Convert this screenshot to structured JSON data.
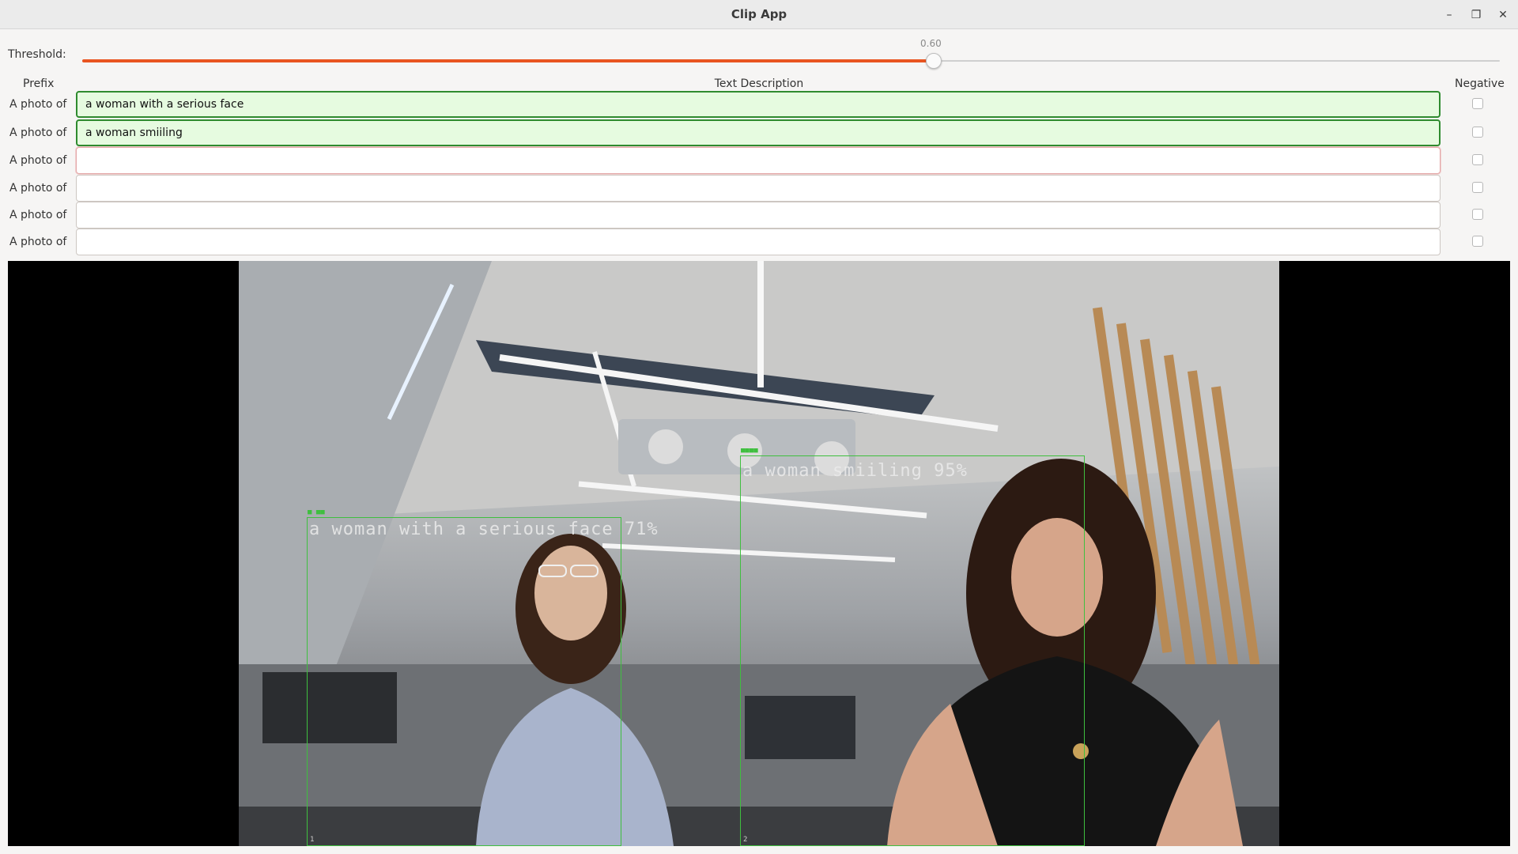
{
  "window": {
    "title": "Clip App",
    "minimize_icon": "minimize-icon",
    "maximize_icon": "maximize-icon",
    "close_icon": "close-icon"
  },
  "threshold": {
    "label": "Threshold:",
    "value_text": "0.60",
    "value": 0.6,
    "accent_color": "#e95420"
  },
  "columns": {
    "prefix": "Prefix",
    "description": "Text Description",
    "negative": "Negative"
  },
  "rows": [
    {
      "prefix": "A photo of",
      "text": "a woman with a serious face",
      "negative": false
    },
    {
      "prefix": "A photo of",
      "text": "a woman smiiling",
      "negative": false
    },
    {
      "prefix": "A photo of",
      "text": "",
      "negative": false
    },
    {
      "prefix": "A photo of",
      "text": "",
      "negative": false
    },
    {
      "prefix": "A photo of",
      "text": "",
      "negative": false
    },
    {
      "prefix": "A photo of",
      "text": "",
      "negative": false
    }
  ],
  "detections": [
    {
      "label": "a woman with a serious face 71%",
      "index": "1"
    },
    {
      "label": "a woman smiiling 95%",
      "index": "2"
    }
  ],
  "colors": {
    "valid_fill": "#e6fbe0",
    "valid_border": "#2f8b2f",
    "detection_box": "#3fbf3f"
  }
}
